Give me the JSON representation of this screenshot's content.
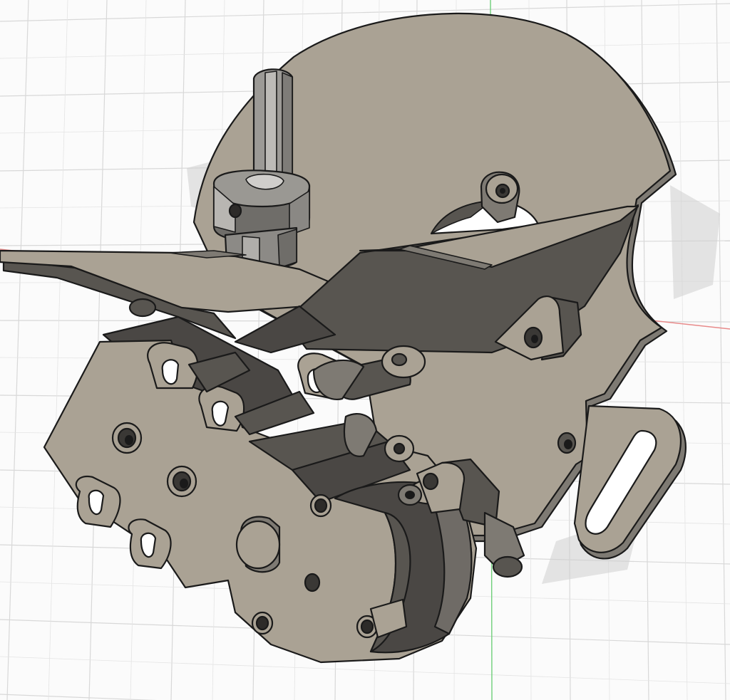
{
  "viewport": {
    "background": "#fbfbfb",
    "grid_color": "#d8d8d8",
    "x_axis_color": "#e88a8a",
    "y_axis_color": "#6fcf7a"
  },
  "model": {
    "part_color": "#aaa294",
    "part_color_dark": "#585550",
    "part_color_mid": "#7e7a73",
    "shaft_color": "#9c9a96",
    "edge_color": "#1a1a1a"
  }
}
